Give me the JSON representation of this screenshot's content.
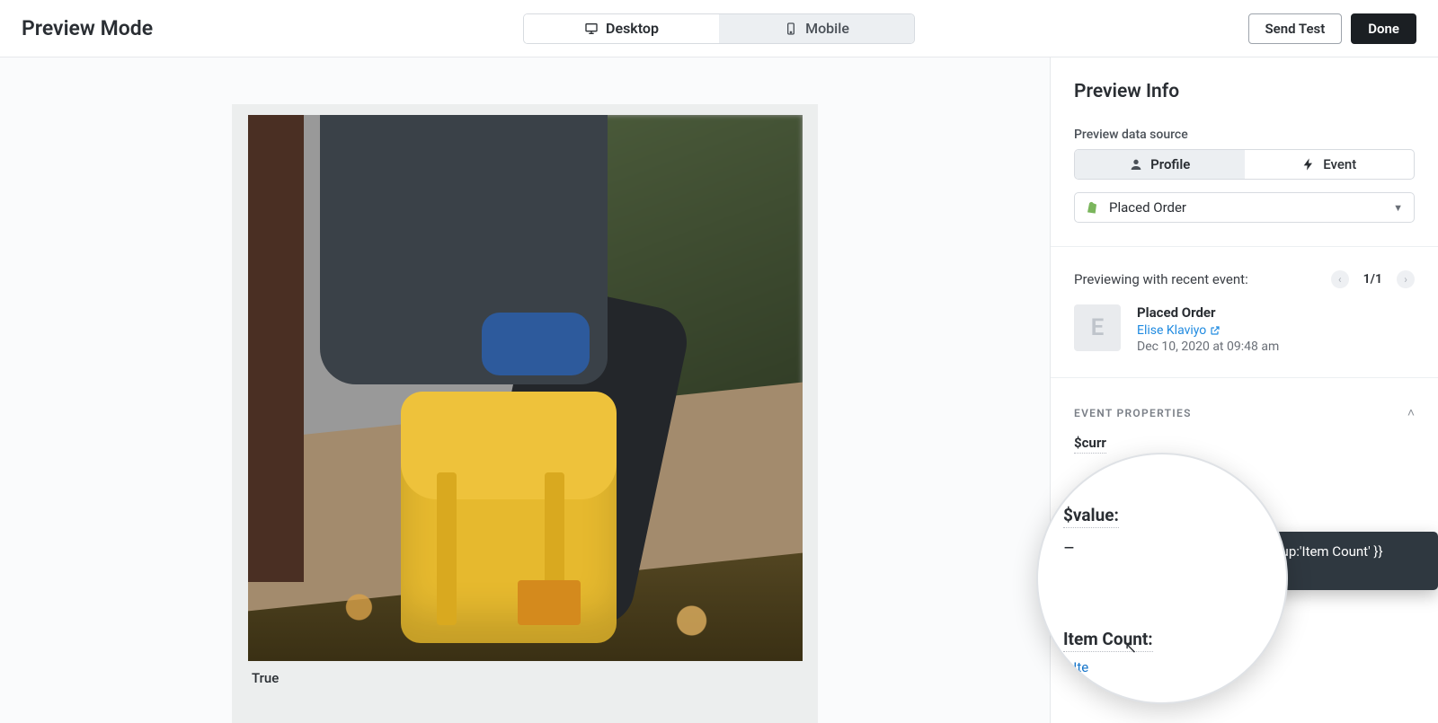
{
  "header": {
    "title": "Preview Mode",
    "desktop_label": "Desktop",
    "mobile_label": "Mobile",
    "send_test_label": "Send Test",
    "done_label": "Done"
  },
  "canvas": {
    "caption": "True"
  },
  "sidebar": {
    "title": "Preview Info",
    "data_source_label": "Preview data source",
    "seg_profile": "Profile",
    "seg_event": "Event",
    "select_value": "Placed Order",
    "previewing_label": "Previewing with recent event:",
    "pager": "1/1",
    "event": {
      "name": "Placed Order",
      "user": "Elise Klaviyo",
      "avatar_initial": "E",
      "timestamp": "Dec 10, 2020 at 09:48 am"
    },
    "section_title": "EVENT PROPERTIES",
    "props": {
      "curr_partial": "$curr",
      "value_label": "$value:",
      "dash": "–",
      "item_count_label": "Item Count:",
      "ite_label": "▸ Ite"
    },
    "tooltip": "Copy {{ event|lookup:'Item Count' }} variable"
  }
}
